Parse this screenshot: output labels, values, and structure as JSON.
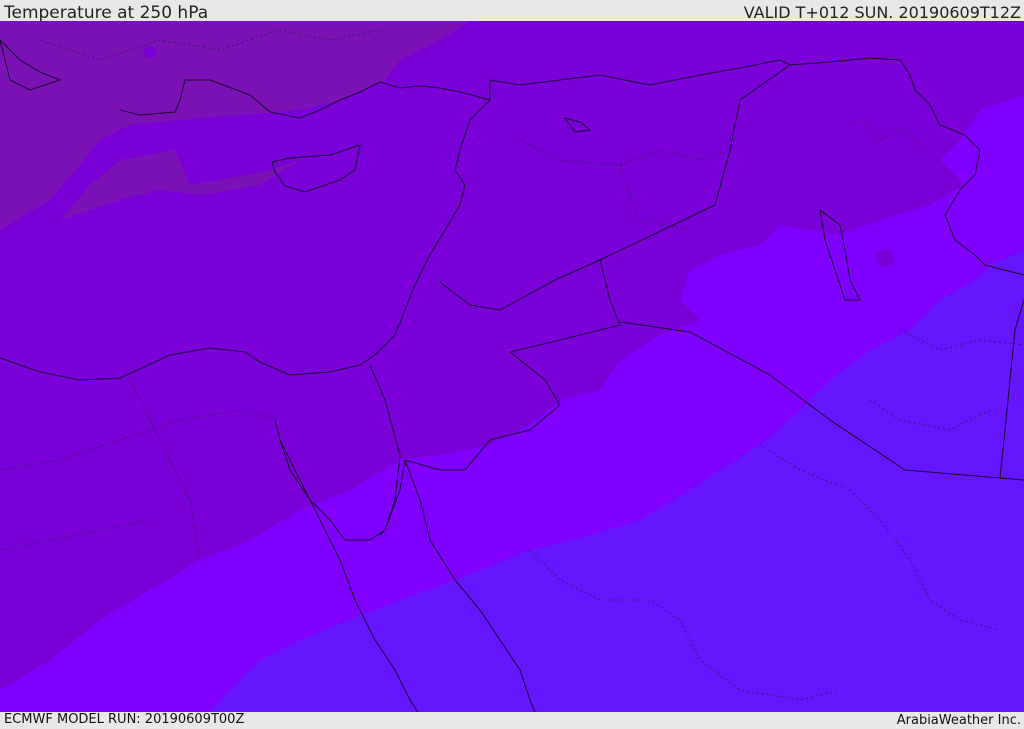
{
  "header": {
    "title": "Temperature at 250 hPa",
    "valid": "VALID T+012 SUN. 20190609T12Z"
  },
  "footer": {
    "model_run": "ECMWF MODEL RUN: 20190609T00Z",
    "credit": "ArabiaWeather Inc."
  },
  "colors": {
    "band_coldest": "#7a12b6",
    "band_cold": "#7a00d8",
    "band_mid": "#8000ff",
    "band_warm": "#6616ff",
    "border": "#1a0a2e",
    "internal_border": "#3a1a66"
  }
}
